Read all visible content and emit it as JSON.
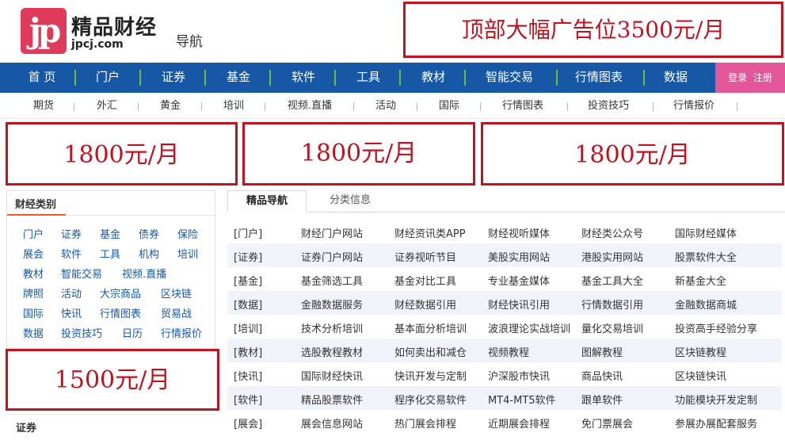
{
  "header": {
    "logo_badge": "jp",
    "logo_cn": "精品财经",
    "logo_domain": "jpcj.com",
    "nav_label": "导航",
    "top_ad": "顶部大幅广告位3500元/月"
  },
  "main_nav": [
    "首 页",
    "门户",
    "证券",
    "基金",
    "软件",
    "工具",
    "教材",
    "智能交易",
    "行情图表",
    "数据"
  ],
  "login": {
    "login_label": "登录",
    "register_label": "注册"
  },
  "sub_nav": [
    "期货",
    "外汇",
    "黄金",
    "培训",
    "视频.直播",
    "活动",
    "国际",
    "行情图表",
    "投资技巧",
    "行情报价"
  ],
  "ads": {
    "a": "1800元/月",
    "b": "1800元/月",
    "c": "1800元/月",
    "d": "1500元/月"
  },
  "category_panel": {
    "title": "财经类别",
    "items": [
      [
        "门户",
        "证券",
        "基金",
        "债券",
        "保险"
      ],
      [
        "展会",
        "软件",
        "工具",
        "机构",
        "培训"
      ],
      [
        "教材",
        "智能交易",
        "视频.直播"
      ],
      [
        "牌照",
        "活动",
        "大宗商品",
        "区块链"
      ],
      [
        "国际",
        "快讯",
        "行情图表",
        "贸易战"
      ],
      [
        "数据",
        "投资技巧",
        "日历",
        "行情报价"
      ]
    ]
  },
  "section_panel": {
    "title": "证券"
  },
  "tabs": {
    "active": "精品导航",
    "other": "分类信息"
  },
  "link_rows": [
    {
      "cat": "[门户]",
      "links": [
        "财经门户网站",
        "财经资讯类APP",
        "财经视听媒体",
        "财经类公众号",
        "国际财经媒体"
      ]
    },
    {
      "cat": "[证券]",
      "links": [
        "证券门户网站",
        "证券视听节目",
        "美股实用网站",
        "港股实用网站",
        "股票软件大全"
      ]
    },
    {
      "cat": "[基金]",
      "links": [
        "基金筛选工具",
        "基金对比工具",
        "专业基金媒体",
        "基金工具大全",
        "新基金大全"
      ]
    },
    {
      "cat": "[数据]",
      "links": [
        "金融数据服务",
        "财经数据引用",
        "财经快讯引用",
        "行情数据引用",
        "金融数据商城"
      ]
    },
    {
      "cat": "[培训]",
      "links": [
        "技术分析培训",
        "基本面分析培训",
        "波浪理论实战培训",
        "量化交易培训",
        "投资高手经验分享"
      ]
    },
    {
      "cat": "[教材]",
      "links": [
        "选股教程教材",
        "如何卖出和减仓",
        "视频教程",
        "图解教程",
        "区块链教程"
      ]
    },
    {
      "cat": "[快讯]",
      "links": [
        "国际财经快讯",
        "快讯开发与定制",
        "沪深股市快讯",
        "商品快讯",
        "区块链快讯"
      ]
    },
    {
      "cat": "[软件]",
      "links": [
        "精品股票软件",
        "程序化交易软件",
        "MT4-MT5软件",
        "跟单软件",
        "功能模块开发定制"
      ]
    },
    {
      "cat": "[展会]",
      "links": [
        "展会信息网站",
        "热门展会排程",
        "近期展会排程",
        "免门票展会",
        "参展办展配套服务"
      ]
    }
  ]
}
